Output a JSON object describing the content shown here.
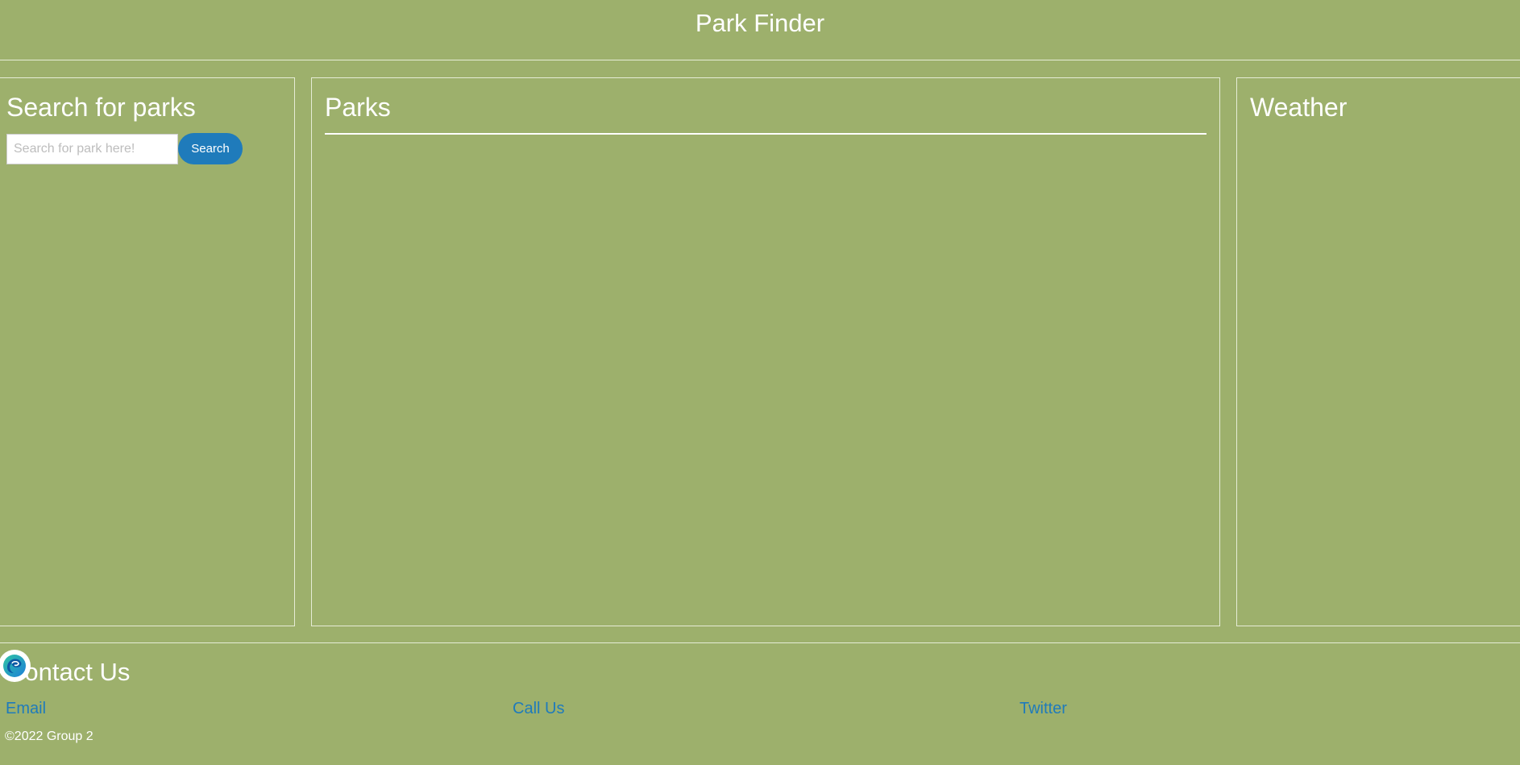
{
  "header": {
    "title": "Park Finder"
  },
  "search_panel": {
    "heading": "Search for parks",
    "input_placeholder": "Search for park here!",
    "input_value": "",
    "button_label": "Search"
  },
  "parks_panel": {
    "heading": "Parks"
  },
  "weather_panel": {
    "heading": "Weather"
  },
  "footer": {
    "heading": "Contact Us",
    "links": [
      "Email",
      "Call Us",
      "Twitter"
    ],
    "copyright": "©2022 Group 2"
  },
  "icons": {
    "browser_badge": "edge-browser-icon"
  },
  "colors": {
    "background": "#9db06c",
    "button": "#1f7bbb",
    "link": "#1f7bbb",
    "text": "#ffffff"
  }
}
